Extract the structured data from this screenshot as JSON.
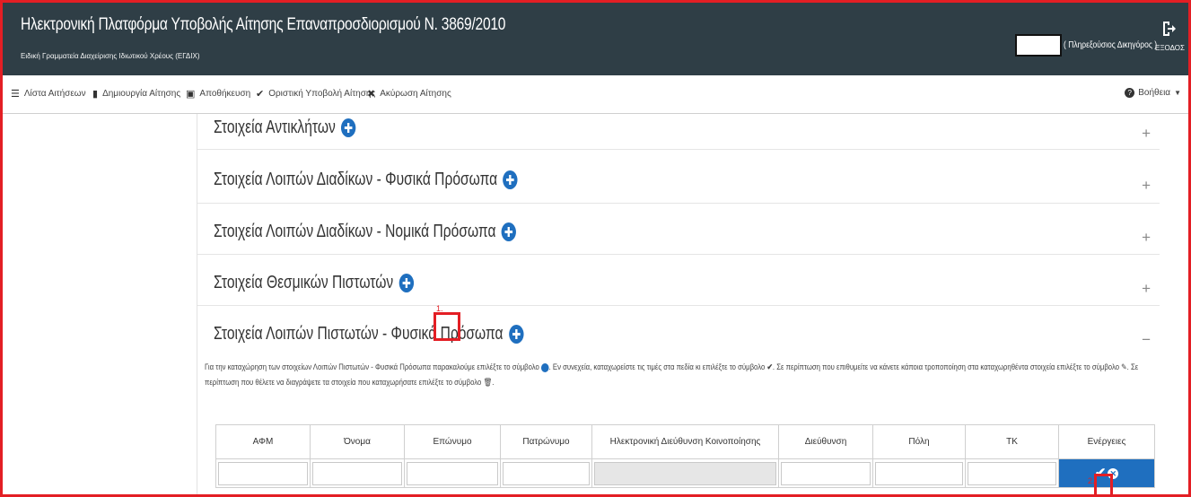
{
  "header": {
    "title": "Ηλεκτρονική Πλατφόρμα Υποβολής Αίτησης Επαναπροσδιορισμού Ν. 3869/2010",
    "subtitle": "Ειδική Γραμματεία Διαχείρισης Ιδιωτικού Χρέους (ΕΓΔΙΧ)",
    "user_role": "( Πληρεξούσιος Δικηγόρος )",
    "logout_label": "ΕΞΟΔΟΣ",
    "logout_icon": "sign-out-icon"
  },
  "toolbar": {
    "items": [
      {
        "label": "Λίστα Αιτήσεων",
        "icon": "list-icon"
      },
      {
        "label": "Δημιουργία Αίτησης",
        "icon": "file-icon"
      },
      {
        "label": "Αποθήκευση",
        "icon": "save-icon"
      },
      {
        "label": "Οριστική Υποβολή Αίτησης",
        "icon": "check-icon"
      },
      {
        "label": "Ακύρωση Αίτησης",
        "icon": "times-icon"
      }
    ],
    "help_label": "Βοήθεια"
  },
  "sections": [
    {
      "title": "Στοιχεία Αντικλήτων",
      "toggle": "+"
    },
    {
      "title": "Στοιχεία Λοιπών Διαδίκων - Φυσικά Πρόσωπα",
      "toggle": "+"
    },
    {
      "title": "Στοιχεία Λοιπών Διαδίκων - Νομικά Πρόσωπα",
      "toggle": "+"
    },
    {
      "title": "Στοιχεία Θεσμικών Πιστωτών",
      "toggle": "+"
    },
    {
      "title": "Στοιχεία Λοιπών Πιστωτών - Φυσικά Πρόσωπα",
      "toggle": "−"
    }
  ],
  "markers": {
    "step1": "1.",
    "step2": "2."
  },
  "info": {
    "line1_a": "Για την καταχώρηση των στοιχείων Λοιπών Πιστωτών - Φυσικά Πρόσωπα παρακαλούμε επιλέξτε το σύμβολο",
    "line1_b": ". Εν συνεχεία, καταχωρείστε τις τιμές στα πεδία κι επιλέξτε το σύμβολο",
    "line1_c": ". Σε περίπτωση που επιθυμείτε να κάνετε κάποια τροποποίηση στα καταχωρηθέντα στοιχεία επιλέξτε το σύμβολο",
    "line1_d": ". Σε",
    "line2_a": "περίπτωση που θέλετε να διαγράψετε τα στοιχεία που καταχωρήσατε επιλέξτε το σύμβολο",
    "line2_b": "."
  },
  "table": {
    "columns": [
      "ΑΦΜ",
      "Όνομα",
      "Επώνυμο",
      "Πατρώνυμο",
      "Ηλεκτρονική Διεύθυνση Κοινοποίησης",
      "Διεύθυνση",
      "Πόλη",
      "ΤΚ",
      "Ενέργειες"
    ],
    "row": [
      "",
      "",
      "",
      "",
      "",
      "",
      "",
      ""
    ]
  }
}
